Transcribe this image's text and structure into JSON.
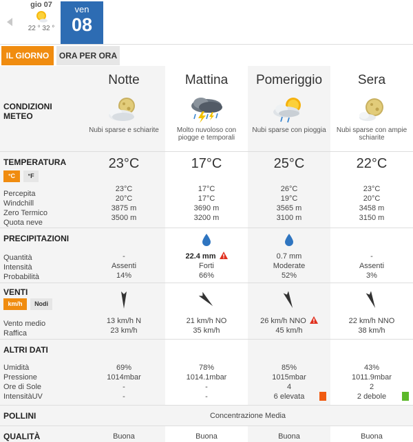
{
  "days": {
    "prev": {
      "name": "gio 07",
      "temps": "22 ° 32 °",
      "icon": "sun-cloud-icon"
    },
    "current": {
      "weekday": "ven",
      "day": "08"
    }
  },
  "tabs": {
    "day": "IL GIORNO",
    "hourly": "ORA PER ORA"
  },
  "periods": [
    "Notte",
    "Mattina",
    "Pomeriggio",
    "Sera"
  ],
  "conditions": {
    "label": "CONDIZIONI METEO",
    "desc": [
      "Nubi sparse e schiarite",
      "Molto nuvoloso con piogge e temporali",
      "Nubi sparse con pioggia",
      "Nubi sparse con ampie schiarite"
    ],
    "icons": [
      "moon-cloud-icon",
      "thunderstorm-icon",
      "sun-rain-icon",
      "moon-cloud-icon"
    ]
  },
  "temperature": {
    "label": "TEMPERATURA",
    "unit_c": "°C",
    "unit_f": "°F",
    "values": [
      "23°C",
      "17°C",
      "25°C",
      "22°C"
    ],
    "rows": [
      "Percepita",
      "Windchill",
      "Zero Termico",
      "Quota neve"
    ],
    "percepita": [
      "23°C",
      "17°C",
      "26°C",
      "23°C"
    ],
    "windchill": [
      "20°C",
      "17°C",
      "19°C",
      "20°C"
    ],
    "zero": [
      "3875 m",
      "3690 m",
      "3565 m",
      "3458 m"
    ],
    "neve": [
      "3500 m",
      "3200 m",
      "3100 m",
      "3150 m"
    ]
  },
  "precip": {
    "label": "PRECIPITAZIONI",
    "rows": [
      "Quantità",
      "Intensità",
      "Probabilità"
    ],
    "quantity": [
      "-",
      "22.4 mm",
      "0.7 mm",
      "-"
    ],
    "intensity": [
      "Assenti",
      "Forti",
      "Moderate",
      "Assenti"
    ],
    "probability": [
      "14%",
      "66%",
      "52%",
      "3%"
    ]
  },
  "wind": {
    "label": "VENTI",
    "unit_kmh": "km/h",
    "unit_knots": "Nodi",
    "rows": [
      "Vento medio",
      "Raffica"
    ],
    "speed": [
      "13 km/h  N",
      "21 km/h NO",
      "26 km/h  NNO",
      "22 km/h NNO"
    ],
    "gust": [
      "23 km/h",
      "35 km/h",
      "45 km/h",
      "38 km/h"
    ],
    "direction_deg": [
      0,
      315,
      337,
      337
    ]
  },
  "other": {
    "label": "ALTRI DATI",
    "rows": [
      "Umidità",
      "Pressione",
      "Ore di Sole",
      "IntensitàUV"
    ],
    "humidity": [
      "69%",
      "78%",
      "85%",
      "43%"
    ],
    "pressure": [
      "1014mbar",
      "1014.1mbar",
      "1015mbar",
      "1011.9mbar"
    ],
    "sun_hours": [
      "-",
      "-",
      "4",
      "2"
    ],
    "uv": [
      "-",
      "-",
      "6 elevata",
      "2 debole"
    ],
    "uv_colors": [
      "",
      "",
      "#f05a10",
      "#5cb82a"
    ]
  },
  "pollen": {
    "label": "POLLINI",
    "value": "Concentrazione Media"
  },
  "air": {
    "label": "QUALITÀ DELL'ARIA",
    "values": [
      "Buona",
      "Buona",
      "Buona",
      "Buona"
    ]
  },
  "colors": {
    "accent": "#f08c10",
    "day_blue": "#2d6cb3",
    "warning": "#e0301e",
    "drop": "#2f75c0"
  }
}
